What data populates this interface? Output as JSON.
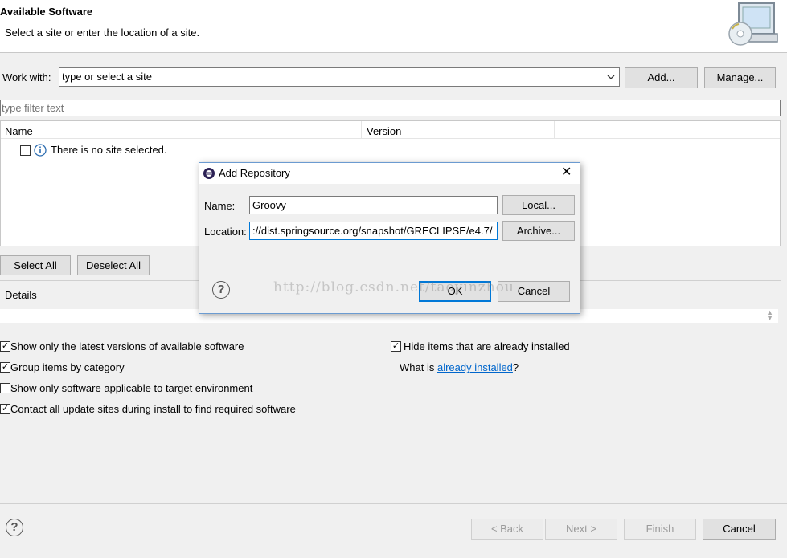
{
  "header": {
    "title": "Available Software",
    "subtitle": "Select a site or enter the location of a site."
  },
  "work_with": {
    "label": "Work with:",
    "value": "type or select a site",
    "add_button": "Add...",
    "manage_button": "Manage..."
  },
  "filter": {
    "placeholder": "type filter text"
  },
  "table": {
    "columns": [
      "Name",
      "Version"
    ],
    "message": "There is no site selected."
  },
  "select_all": "Select All",
  "deselect_all": "Deselect All",
  "details_label": "Details",
  "options": {
    "show_latest": {
      "label": "Show only the latest versions of available software",
      "checked": true
    },
    "group_by_category": {
      "label": "Group items by category",
      "checked": true
    },
    "show_applicable": {
      "label": "Show only software applicable to target environment",
      "checked": false
    },
    "contact_sites": {
      "label": "Contact all update sites during install to find required software",
      "checked": true
    },
    "hide_installed": {
      "label": "Hide items that are already installed",
      "checked": true
    }
  },
  "what_is": {
    "prefix": "What is ",
    "link": "already installed",
    "suffix": "?"
  },
  "dialog": {
    "title": "Add Repository",
    "name_label": "Name:",
    "name_value": "Groovy",
    "location_label": "Location:",
    "location_value": "://dist.springsource.org/snapshot/GRECLIPSE/e4.7/",
    "local_button": "Local...",
    "archive_button": "Archive...",
    "ok_button": "OK",
    "cancel_button": "Cancel"
  },
  "watermark": "http://blog.csdn.net/taoyinzhou",
  "footer": {
    "back": "< Back",
    "next": "Next >",
    "finish": "Finish",
    "cancel": "Cancel"
  }
}
